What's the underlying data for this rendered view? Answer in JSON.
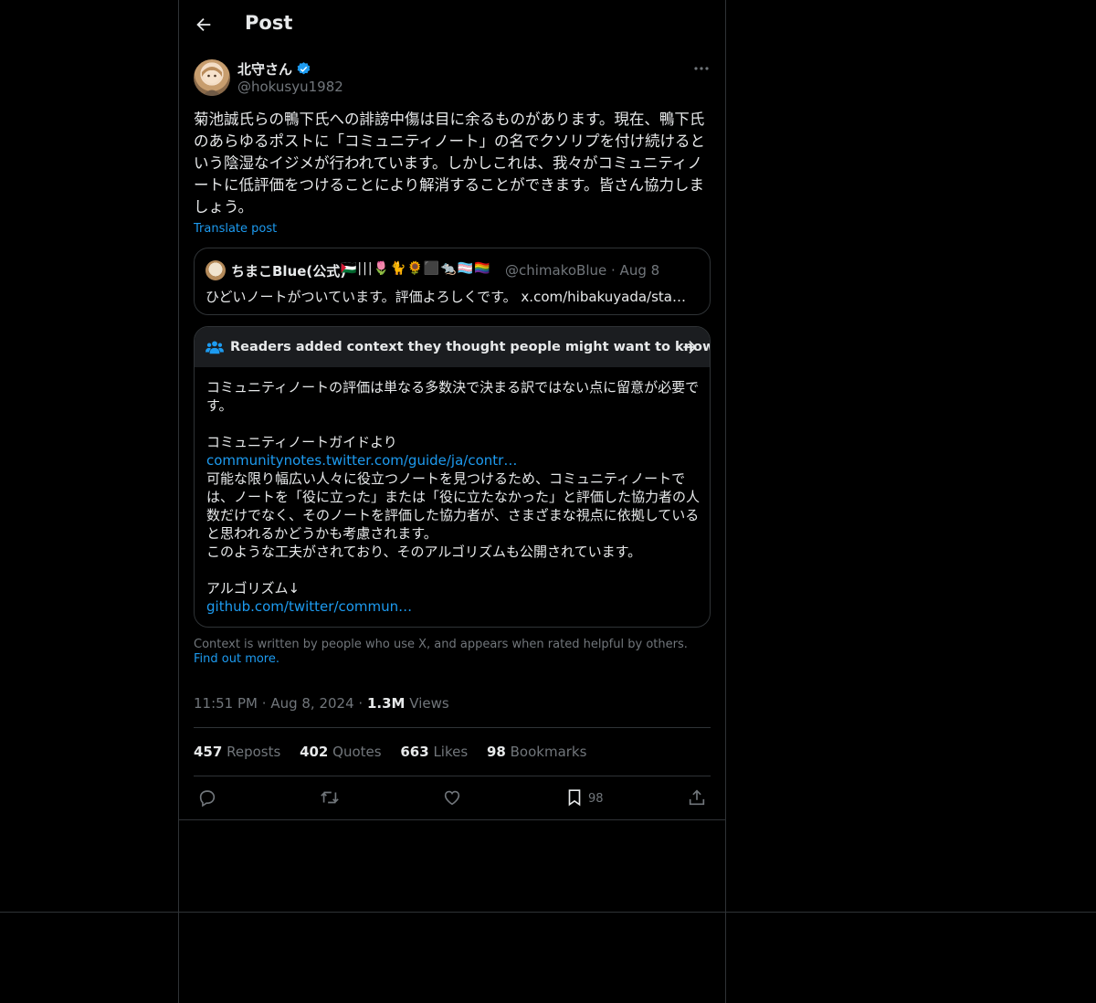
{
  "header": {
    "title": "Post"
  },
  "post": {
    "display_name": "北守さん",
    "handle": "@hokusyu1982",
    "text": "菊池誠氏らの鴨下氏への誹謗中傷は目に余るものがあります。現在、鴨下氏のあらゆるポストに「コミュニティノート」の名でクソリプを付け続けるという陰湿なイジメが行われています。しかしこれは、我々がコミュニティノートに低評価をつけることにより解消することができます。皆さん協力しましょう。",
    "translate_label": "Translate post",
    "time": "11:51 PM",
    "date": "Aug 8, 2024",
    "views_count": "1.3M",
    "views_label": "Views",
    "sep": "·"
  },
  "quote": {
    "display_name": "ちまこBlue(公式)",
    "emojis": "🇵🇸|||🌷🐈🌻⬛🐀🏳️‍⚧️🏳️‍🌈",
    "handle": "@chimakoBlue · Aug 8",
    "text": "ひどいノートがついています。評価よろしくです。 x.com/hibakuyada/sta…"
  },
  "note": {
    "heading": "Readers added context they thought people might want to know",
    "line1": "コミュニティノートの評価は単なる多数決で決まる訳ではない点に留意が必要です。",
    "line2": "コミュニティノートガイドより",
    "link1": "communitynotes.twitter.com/guide/ja/contr…",
    "line3": "可能な限り幅広い人々に役立つノートを見つけるため、コミュニティノートでは、ノートを「役に立った」または「役に立たなかった」と評価した協力者の人数だけでなく、そのノートを評価した協力者が、さまざまな視点に依拠していると思われるかどうかも考慮されます。",
    "line4": "このような工夫がされており、そのアルゴリズムも公開されています。",
    "line5": "アルゴリズム↓",
    "link2": "github.com/twitter/commun…"
  },
  "disclaimer": {
    "text": "Context is written by people who use X, and appears when rated helpful by others.",
    "link": "Find out more."
  },
  "stats": {
    "reposts_count": "457",
    "reposts_label": "Reposts",
    "quotes_count": "402",
    "quotes_label": "Quotes",
    "likes_count": "663",
    "likes_label": "Likes",
    "bookmarks_count": "98",
    "bookmarks_label": "Bookmarks"
  },
  "actions": {
    "bookmark_count": "98"
  },
  "colors": {
    "accent": "#1d9bf0",
    "muted": "#71767b",
    "text": "#e7e9ea",
    "border": "#2f3336",
    "background": "#000000"
  },
  "icons": [
    "back-arrow-icon",
    "verified-badge-icon",
    "more-icon",
    "community-notes-icon",
    "arrow-right-icon",
    "reply-icon",
    "repost-icon",
    "like-icon",
    "bookmark-icon",
    "share-icon"
  ]
}
